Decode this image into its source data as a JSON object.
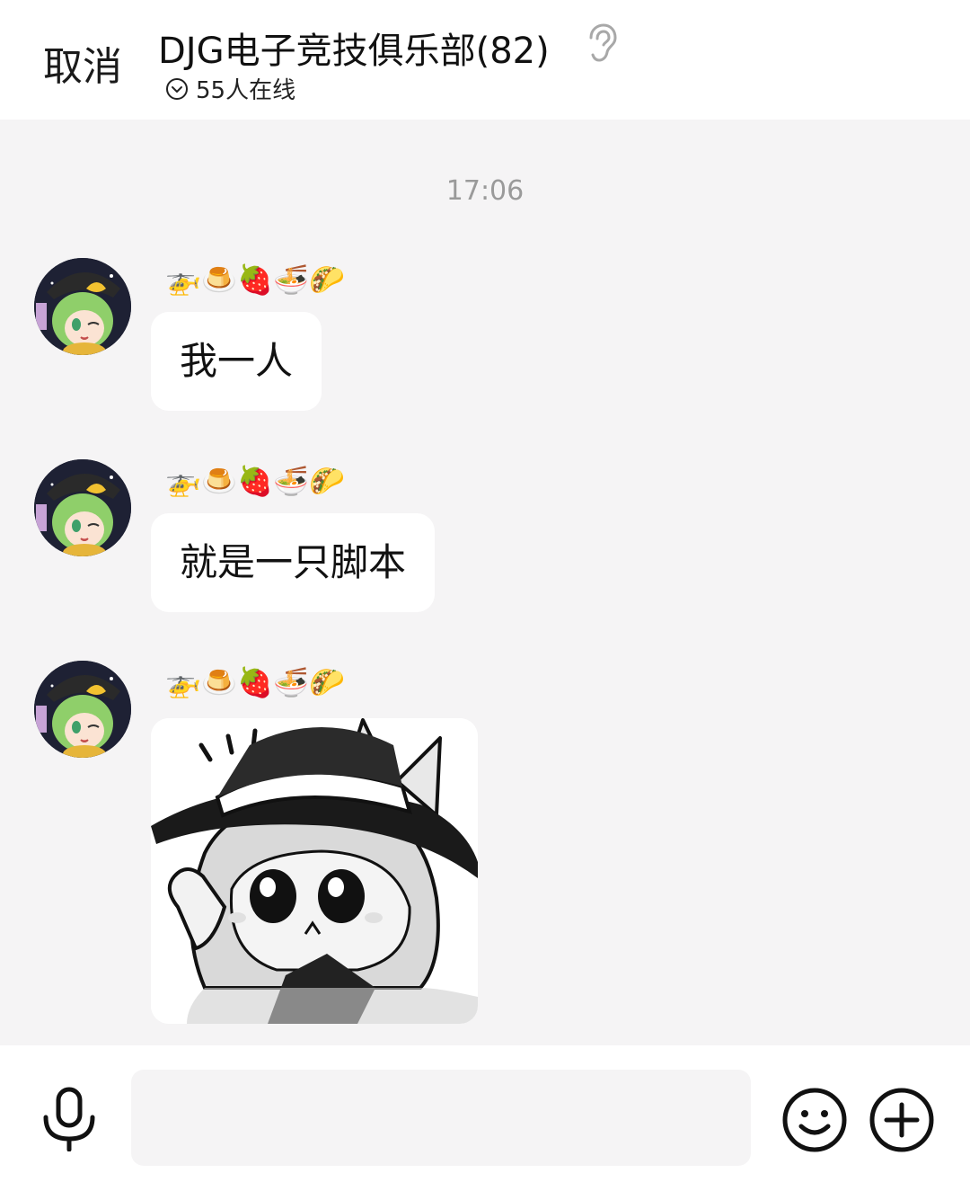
{
  "header": {
    "cancel_label": "取消",
    "title": "DJG电子竞技俱乐部(82)",
    "online_text": "55人在线"
  },
  "chat": {
    "time": "17:06",
    "nickname_emojis": [
      "🚁",
      "🍮",
      "🍓",
      "🍜",
      "🌮"
    ],
    "messages": [
      {
        "type": "text",
        "text": "我一人"
      },
      {
        "type": "text",
        "text": "就是一只脚本"
      },
      {
        "type": "sticker",
        "sticker": "anime-girl-sticker"
      }
    ]
  },
  "footer": {
    "input_value": "",
    "icons": [
      "microphone-icon",
      "emoji-icon",
      "plus-icon"
    ]
  },
  "colors": {
    "background": "#f5f4f5",
    "header_bg": "#ffffff",
    "bubble_bg": "#ffffff",
    "time_text": "#9a9a9a"
  }
}
